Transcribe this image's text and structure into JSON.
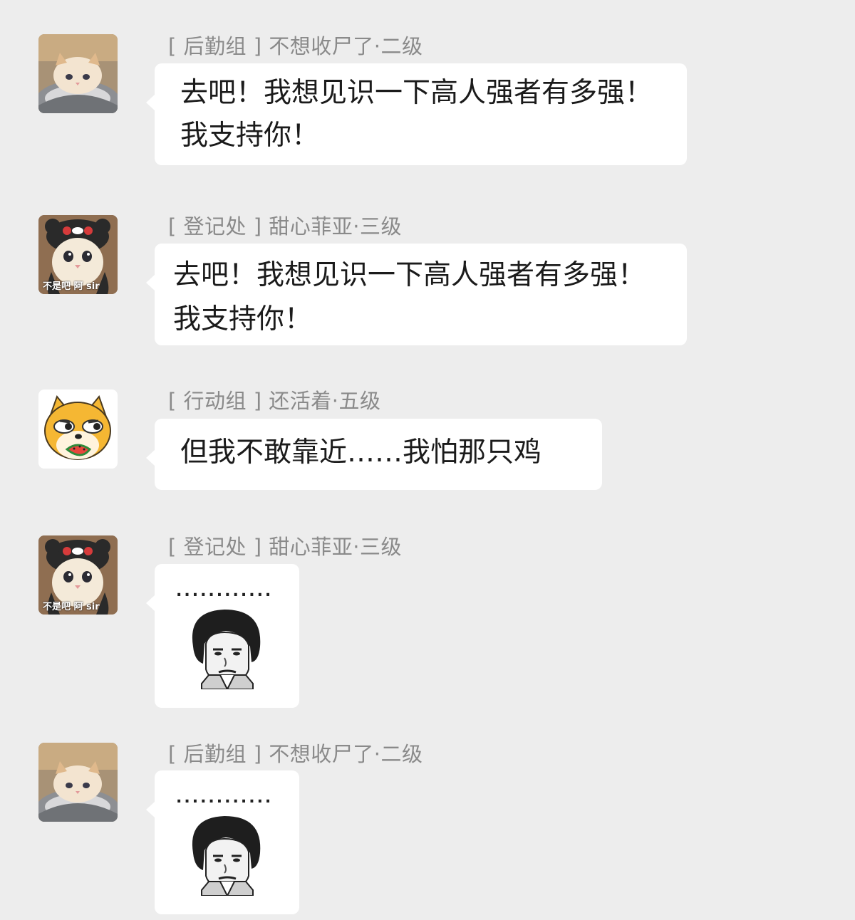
{
  "messages": [
    {
      "sender": "[ 后勤组 ] 不想收尸了·二级",
      "avatar": "cat-in-bowl-avatar",
      "text": "去吧！我想见识一下高人强者有多强！\n我支持你！"
    },
    {
      "sender": "[ 登记处 ] 甜心菲亚·三级",
      "avatar": "cat-with-bear-hat-avatar",
      "avatar_caption": "不是吧 阿 sir",
      "text": "去吧！我想见识一下高人强者有多强！\n我支持你！"
    },
    {
      "sender": "[ 行动组 ] 还活着·五级",
      "avatar": "shiba-dog-eating-watermelon-avatar",
      "text": "但我不敢靠近……我怕那只鸡"
    },
    {
      "sender": "[ 登记处 ] 甜心菲亚·三级",
      "avatar": "cat-with-bear-hat-avatar",
      "avatar_caption": "不是吧 阿 sir",
      "sticker_text": "............",
      "sticker": "bowl-cut-face-sticker"
    },
    {
      "sender": "[ 后勤组 ] 不想收尸了·二级",
      "avatar": "cat-in-bowl-avatar",
      "sticker_text": "............",
      "sticker": "bowl-cut-face-sticker"
    }
  ]
}
